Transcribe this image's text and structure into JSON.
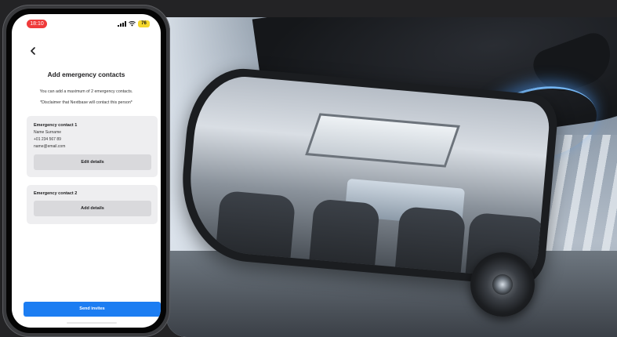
{
  "status_bar": {
    "time": "18:10",
    "battery": "76",
    "icons": [
      "signal-icon",
      "wifi-icon",
      "battery-icon"
    ]
  },
  "nav": {
    "back_icon": "chevron-left-icon"
  },
  "page": {
    "title": "Add emergency contacts",
    "subtitle": "You can add a maximum of 2 emergency contacts.",
    "disclaimer": "*Disclaimer that Nextbase will contact this person*"
  },
  "contacts": [
    {
      "title": "Emergency contact 1",
      "name": "Name Surname",
      "phone": "+01 234 567 89",
      "email": "name@email.com",
      "button_label": "Edit details"
    },
    {
      "title": "Emergency contact 2",
      "button_label": "Add details"
    }
  ],
  "footer": {
    "send_label": "Send invites"
  },
  "colors": {
    "accent": "#1c7df2",
    "time_pill": "#ef3a3a",
    "battery": "#f5d72a",
    "background": "#232325",
    "card": "#eeeef0",
    "glow": "#78beff"
  }
}
